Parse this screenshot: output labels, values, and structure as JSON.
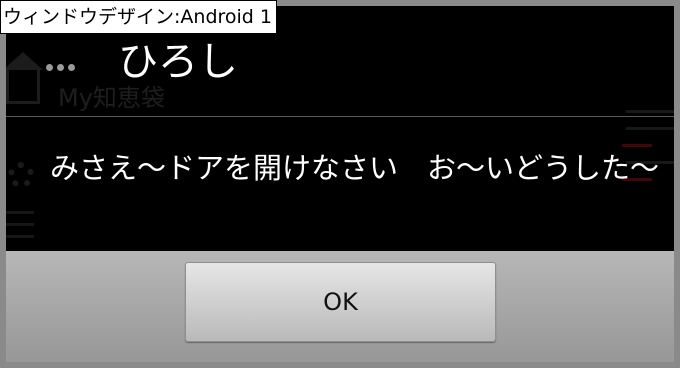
{
  "window_label": "ウィンドウデザイン:Android 1",
  "background_app": {
    "title": "My知恵袋"
  },
  "dialog": {
    "title": "ひろし",
    "message": "みさえ～ドアを開けなさい　お～いどうした～",
    "ok_label": "OK"
  },
  "colors": {
    "frame": "#8a8a8a",
    "window_bg": "#000000",
    "button_bar": "#a8a8a8",
    "text": "#ffffff"
  }
}
